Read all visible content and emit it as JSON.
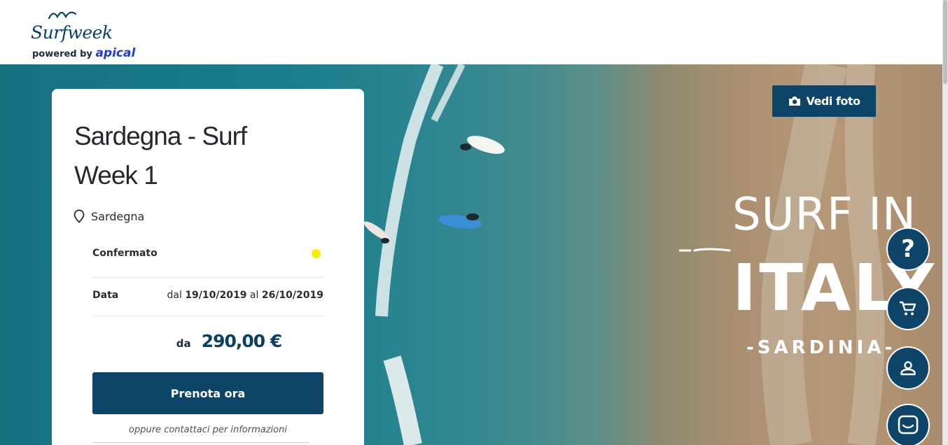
{
  "header": {
    "logo_script": "Surfweek",
    "logo_powered_prefix": "powered by",
    "logo_brand": "apical"
  },
  "hero": {
    "photo_button_label": "Vedi foto",
    "overlay": {
      "line1": "SURF IN",
      "line2": "ITALY",
      "line3": "-SARDINIA-"
    }
  },
  "card": {
    "title": "Sardegna - Surf Week 1",
    "location": "Sardegna",
    "status_label": "Confermato",
    "status_color": "#f5ef05",
    "date_label": "Data",
    "date_from_prefix": "dal",
    "date_from": "19/10/2019",
    "date_to_prefix": "al",
    "date_to": "26/10/2019",
    "price_prefix": "da",
    "price": "290,00 €",
    "book_button": "Prenota ora",
    "contact_text": "oppure contattaci per informazioni"
  },
  "fabs": {
    "help_label": "?",
    "icons": [
      "question-icon",
      "cart-icon",
      "user-icon",
      "chat-icon"
    ]
  },
  "colors": {
    "primary": "#0f4469",
    "brand_blue": "#1f3bd6"
  }
}
